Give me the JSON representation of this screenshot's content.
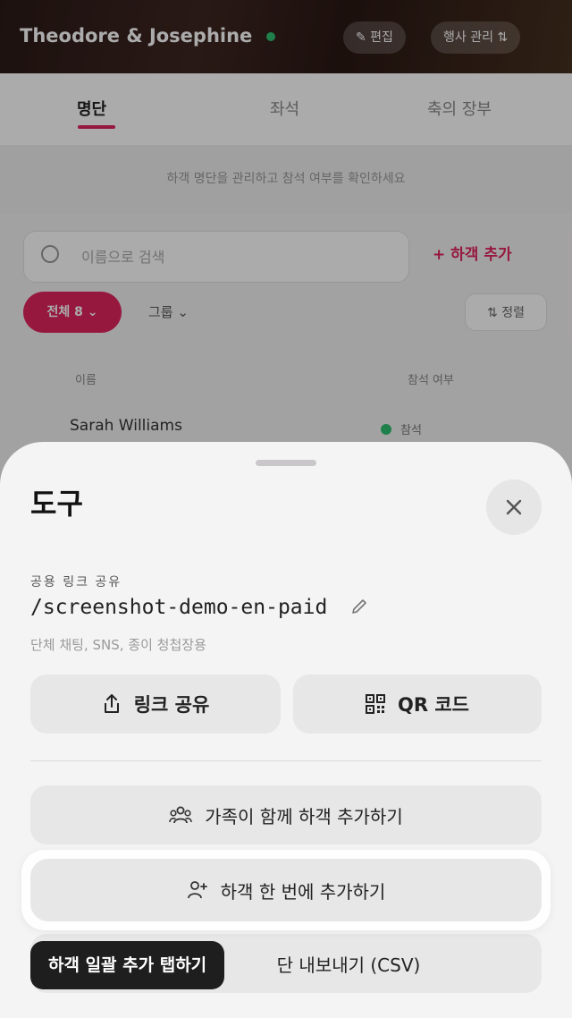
{
  "background": {
    "couple_name": "Theodore & Josephine",
    "hero_buttons": [
      "✎ 편집",
      "행사 관리 ⇅"
    ],
    "tabs": [
      {
        "label": "명단",
        "active": true
      },
      {
        "label": "좌석",
        "active": false
      },
      {
        "label": "축의 장부",
        "active": false
      }
    ],
    "notice": "하객 명단을 관리하고 참석 여부를 확인하세요",
    "search_placeholder": "이름으로 검색",
    "add_guest_label": "+ 하객 추가",
    "filter_all_label": "전체 8 ⌄",
    "filter_group_label": "그룹 ⌄",
    "sort_label": "⇅ 정렬",
    "column_headers": [
      "이름",
      "참석 여부"
    ],
    "first_row": {
      "name": "Sarah Williams",
      "status": "참석"
    }
  },
  "sheet": {
    "title": "도구",
    "close_icon": "close-icon",
    "share_link_label": "공용 링크 공유",
    "share_link_slug": "/screenshot-demo-en-paid",
    "share_link_hint": "단체 채팅, SNS, 종이 청첩장용",
    "share_button_label": "링크 공유",
    "qr_button_label": "QR 코드",
    "family_add_label": "가족이 함께 하객 추가하기",
    "bulk_add_label": "하객 한 번에 추가하기",
    "export_label": "단 내보내기 (CSV)"
  },
  "tutorial": {
    "tooltip": "하객 일괄 추가 탭하기"
  },
  "colors": {
    "accent": "#e0245e",
    "tooltip_bg": "#1e1e1e",
    "sheet_bg": "#f5f4f5",
    "button_bg": "#e8e7e8",
    "status_green": "#2fbf71"
  }
}
